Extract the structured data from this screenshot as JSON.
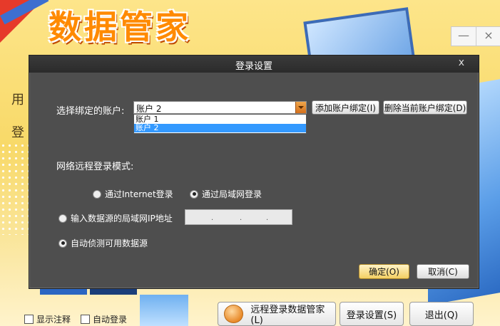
{
  "background": {
    "app_logo_text": "数据管家",
    "left_texts": [
      "用",
      "登"
    ],
    "window_buttons": {
      "minimize": "—",
      "close": "×"
    },
    "checkboxes": [
      {
        "label": "显示注释",
        "checked": false
      },
      {
        "label": "自动登录",
        "checked": false
      }
    ],
    "buttons": {
      "remote_login": "远程登录数据管家(L)",
      "login_settings": "登录设置(S)",
      "exit": "退出(Q)"
    }
  },
  "dialog": {
    "title": "登录设置",
    "close_glyph": "x",
    "account_label": "选择绑定的账户:",
    "account_selected": "账户 2",
    "account_options": [
      "账户 1",
      "账户 2"
    ],
    "add_binding_button": "添加账户绑定(I)",
    "delete_binding_button": "删除当前账户绑定(D)",
    "remote_mode_label": "网络远程登录模式:",
    "radio_internet": "通过Internet登录",
    "radio_lan": "通过局域网登录",
    "selected_mode": "lan",
    "radio_input_ip": "输入数据源的局域网IP地址",
    "radio_auto_detect": "自动侦测可用数据源",
    "selected_source": "auto",
    "ip_value": [
      "",
      "",
      "",
      ""
    ],
    "ok_button": "确定(O)",
    "cancel_button": "取消(C)"
  },
  "colors": {
    "dialog_bg": "#4e4e4e",
    "titlebar": "#2b2b2b",
    "selection": "#3399ff",
    "ok_button": "#f4cf63"
  }
}
